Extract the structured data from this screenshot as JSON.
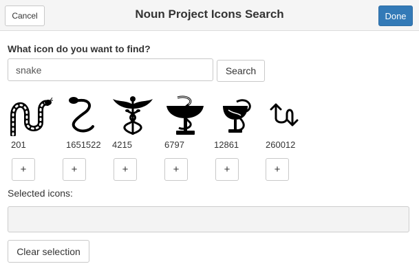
{
  "header": {
    "title": "Noun Project Icons Search",
    "cancel_label": "Cancel",
    "done_label": "Done",
    "done_color": "#337ab7"
  },
  "search": {
    "question": "What icon do you want to find?",
    "value": "snake",
    "button_label": "Search"
  },
  "results": [
    {
      "id": "201",
      "icon": "snake-icon",
      "add_label": "+"
    },
    {
      "id": "1651522",
      "icon": "snake-s-icon",
      "add_label": "+"
    },
    {
      "id": "4215",
      "icon": "caduceus-icon",
      "add_label": "+"
    },
    {
      "id": "6797",
      "icon": "bowl-of-hygieia-icon",
      "add_label": "+"
    },
    {
      "id": "12861",
      "icon": "pharmacy-bowl-icon",
      "add_label": "+"
    },
    {
      "id": "260012",
      "icon": "swap-arrows-icon",
      "add_label": "+"
    }
  ],
  "selection": {
    "label": "Selected icons:",
    "clear_label": "Clear selection"
  }
}
